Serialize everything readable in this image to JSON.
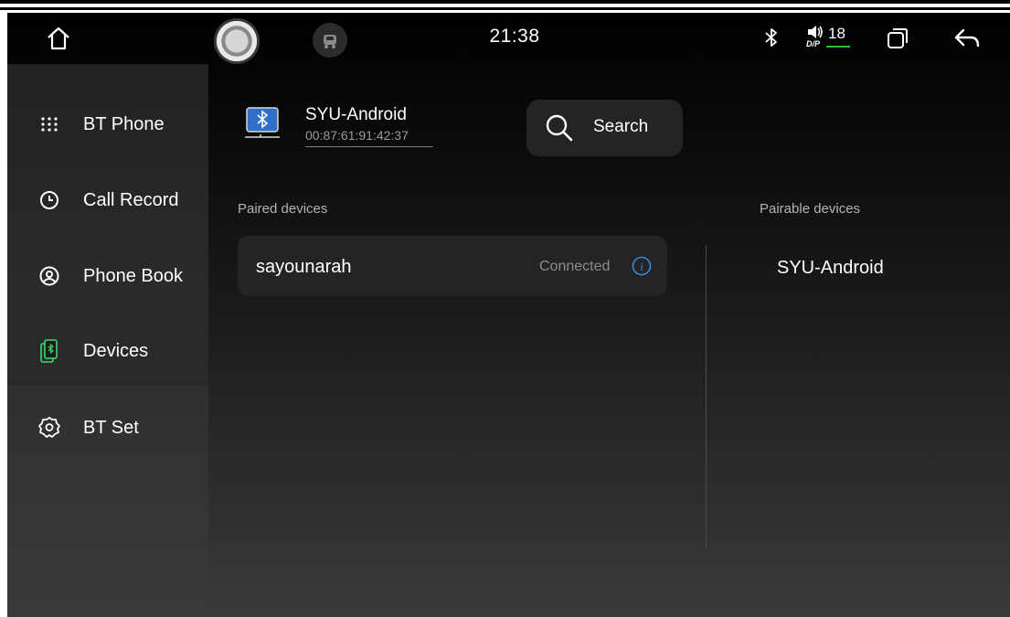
{
  "status_bar": {
    "time": "21:38",
    "volume_level": "18",
    "volume_label": "D/P",
    "icons": [
      "home-icon",
      "assistant-icon",
      "car-icon",
      "bluetooth-icon",
      "volume-icon",
      "recent-apps-icon",
      "back-icon"
    ],
    "accent_color": "#2fbe3b"
  },
  "sidebar": {
    "items": [
      {
        "label": "BT Phone",
        "icon": "dialpad-icon"
      },
      {
        "label": "Call Record",
        "icon": "clock-icon"
      },
      {
        "label": "Phone Book",
        "icon": "contact-icon"
      },
      {
        "label": "Devices",
        "icon": "phone-bluetooth-icon",
        "active": true
      },
      {
        "label": "BT Set",
        "icon": "gear-icon"
      }
    ],
    "active_icon_color": "#39c46a"
  },
  "local_device": {
    "name": "SYU-Android",
    "mac": "00:87:61:91:42:37",
    "icon_color": "#2f6fc7"
  },
  "search": {
    "label": "Search"
  },
  "paired": {
    "title": "Paired devices",
    "devices": [
      {
        "name": "sayounarah",
        "status": "Connected"
      }
    ],
    "info_color": "#3b86e8"
  },
  "pairable": {
    "title": "Pairable devices",
    "devices": [
      {
        "name": "SYU-Android"
      }
    ]
  }
}
